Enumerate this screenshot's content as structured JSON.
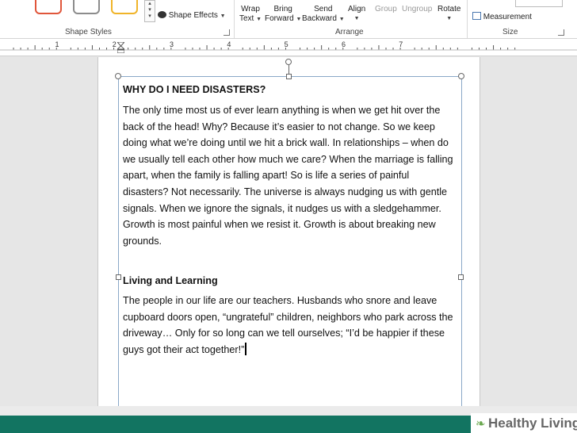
{
  "ribbon": {
    "shape_styles": {
      "shape_effects_label": "Shape Effects",
      "group_label": "Shape Styles"
    },
    "arrange": {
      "wrap_text": [
        "Wrap",
        "Text"
      ],
      "bring_forward": [
        "Bring",
        "Forward"
      ],
      "send_backward": [
        "Send",
        "Backward"
      ],
      "align": "Align",
      "group": "Group",
      "ungroup": "Ungroup",
      "rotate": "Rotate",
      "group_label": "Arrange"
    },
    "size": {
      "measurement": "Measurement",
      "group_label": "Size"
    },
    "colors": {
      "swatch1": "#e0563b",
      "swatch2": "#8c8c8c",
      "swatch3": "#f0b429"
    }
  },
  "document": {
    "heading1": "WHY DO I NEED DISASTERS?",
    "paragraph1": "The only time most us of ever learn anything is when we get hit over the back of the head! Why? Because it’s easier to not change. So we keep doing what we’re doing until we hit a brick wall. In relationships – when do we usually tell each other how much we care? When the marriage is falling apart, when the family is falling apart! So is life a series of painful disasters? Not necessarily. The universe is always nudging us with gentle signals. When we ignore the signals, it nudges us with a sledgehammer. Growth is most painful when we resist it. Growth is about breaking new grounds.",
    "heading2": "Living and Learning",
    "paragraph2": "The people in our life are our teachers. Husbands who snore and leave cupboard doors open, “ungrateful” children, neighbors who park across the driveway… Only for so long can we tell ourselves; “I’d be happier if these guys got their act together!”"
  },
  "ruler": {
    "numbers": [
      "1",
      "2",
      "3",
      "4",
      "5",
      "6",
      "7"
    ]
  },
  "watermark": {
    "brand": "Healthy Living"
  }
}
